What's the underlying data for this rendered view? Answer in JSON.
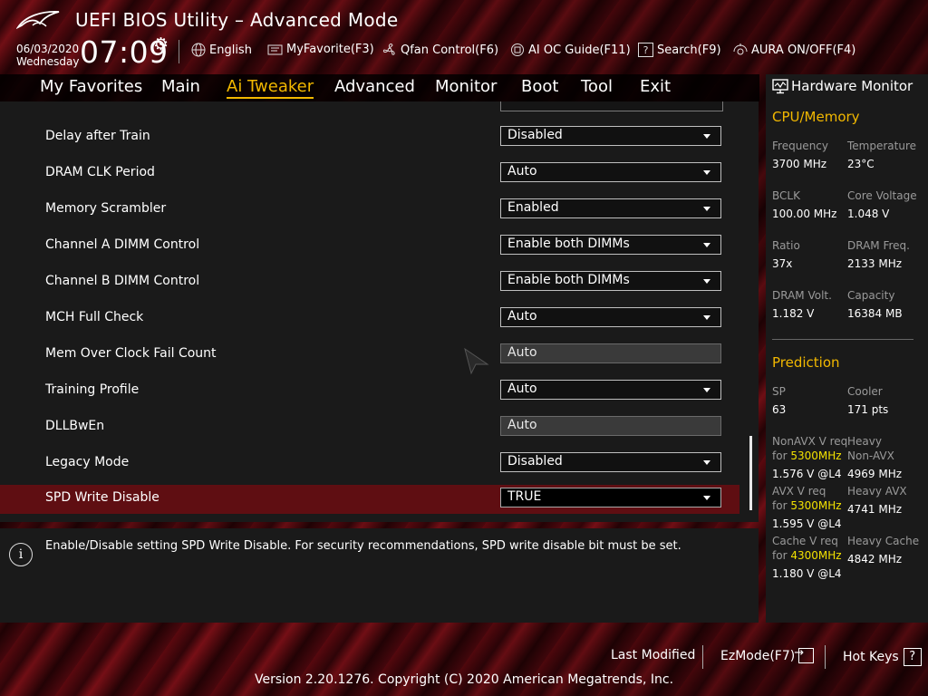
{
  "app": {
    "title": "UEFI BIOS Utility – Advanced Mode"
  },
  "clock": {
    "date": "06/03/2020",
    "weekday": "Wednesday",
    "time": "07:09"
  },
  "toolbar": {
    "language": "English",
    "myfavorite": "MyFavorite(F3)",
    "qfan": "Qfan Control(F6)",
    "aioc": "AI OC Guide(F11)",
    "search": "Search(F9)",
    "aura": "AURA ON/OFF(F4)"
  },
  "nav": {
    "tabs": [
      "My Favorites",
      "Main",
      "Ai Tweaker",
      "Advanced",
      "Monitor",
      "Boot",
      "Tool",
      "Exit"
    ],
    "active": "Ai Tweaker"
  },
  "settings": [
    {
      "label": "Delay after Train",
      "value": "Disabled",
      "state": "normal"
    },
    {
      "label": "DRAM CLK Period",
      "value": "Auto",
      "state": "normal"
    },
    {
      "label": "Memory Scrambler",
      "value": "Enabled",
      "state": "normal"
    },
    {
      "label": "Channel A DIMM Control",
      "value": "Enable both DIMMs",
      "state": "normal"
    },
    {
      "label": "Channel B DIMM Control",
      "value": "Enable both DIMMs",
      "state": "normal"
    },
    {
      "label": "MCH Full Check",
      "value": "Auto",
      "state": "normal"
    },
    {
      "label": "Mem Over Clock Fail Count",
      "value": "Auto",
      "state": "disabled"
    },
    {
      "label": "Training Profile",
      "value": "Auto",
      "state": "normal"
    },
    {
      "label": "DLLBwEn",
      "value": "Auto",
      "state": "disabled"
    },
    {
      "label": "Legacy Mode",
      "value": "Disabled",
      "state": "normal"
    },
    {
      "label": "SPD Write Disable",
      "value": "TRUE",
      "state": "selected"
    }
  ],
  "help": {
    "text": "Enable/Disable setting SPD Write Disable. For security recommendations, SPD write disable bit must be set."
  },
  "hw": {
    "title": "Hardware Monitor",
    "cpu_mem": {
      "heading": "CPU/Memory",
      "frequency_label": "Frequency",
      "frequency": "3700 MHz",
      "temperature_label": "Temperature",
      "temperature": "23°C",
      "bclk_label": "BCLK",
      "bclk": "100.00 MHz",
      "core_voltage_label": "Core Voltage",
      "core_voltage": "1.048 V",
      "ratio_label": "Ratio",
      "ratio": "37x",
      "dram_freq_label": "DRAM Freq.",
      "dram_freq": "2133 MHz",
      "dram_volt_label": "DRAM Volt.",
      "dram_volt": "1.182 V",
      "capacity_label": "Capacity",
      "capacity": "16384 MB"
    },
    "prediction": {
      "heading": "Prediction",
      "sp_label": "SP",
      "sp": "63",
      "cooler_label": "Cooler",
      "cooler": "171 pts",
      "nonavx_label": "NonAVX V req",
      "for_label": "for",
      "nonavx_freq": "5300MHz",
      "nonavx_v": "1.576 V @L4",
      "heavy_nonavx_label_1": "Heavy",
      "heavy_nonavx_label_2": "Non-AVX",
      "heavy_nonavx": "4969 MHz",
      "avx_label": "AVX V req",
      "avx_freq": "5300MHz",
      "avx_v": "1.595 V @L4",
      "heavy_avx_label": "Heavy AVX",
      "heavy_avx": "4741 MHz",
      "cache_label": "Cache V req",
      "cache_freq": "4300MHz",
      "cache_v": "1.180 V @L4",
      "heavy_cache_label": "Heavy Cache",
      "heavy_cache": "4842 MHz"
    }
  },
  "footer": {
    "last_modified": "Last Modified",
    "ezmode": "EzMode(F7)",
    "hotkeys": "Hot Keys",
    "hotkeys_icon": "?",
    "version": "Version 2.20.1276. Copyright (C) 2020 American Megatrends, Inc."
  },
  "colors": {
    "accent": "#f2b800",
    "selected_row": "#5f0e12",
    "panel": "#1a1a1a",
    "highlight_freq": "#f2e100"
  },
  "icons": [
    "rog-logo-icon",
    "gear-icon",
    "globe-icon",
    "favorite-icon",
    "fan-icon",
    "ai-oc-icon",
    "search-icon",
    "aura-icon",
    "monitor-icon",
    "info-icon",
    "exit-icon",
    "question-icon",
    "mouse-cursor-icon"
  ]
}
